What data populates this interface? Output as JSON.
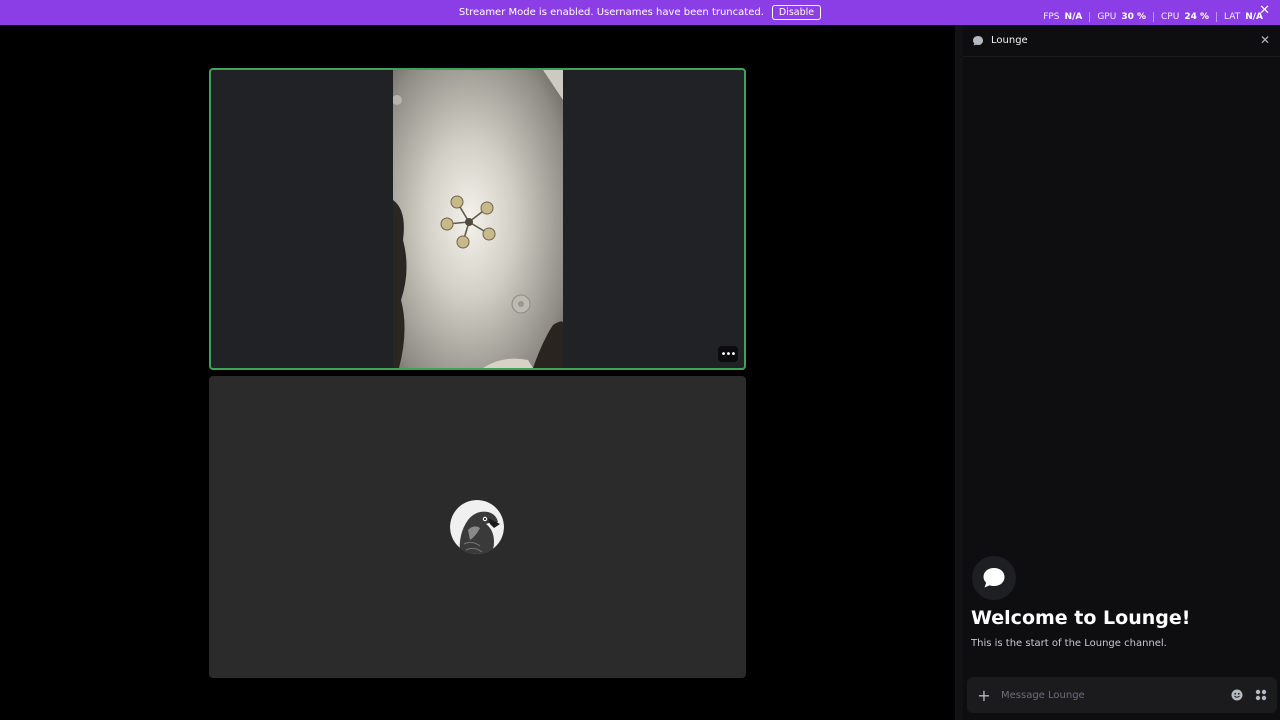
{
  "banner": {
    "message": "Streamer Mode is enabled. Usernames have been truncated.",
    "button_label": "Disable",
    "close_glyph": "✕",
    "color": "#8c3ee6"
  },
  "stats": [
    {
      "label": "FPS",
      "value": "N/A"
    },
    {
      "label": "GPU",
      "value": "30 %"
    },
    {
      "label": "CPU",
      "value": "24 %"
    },
    {
      "label": "LAT",
      "value": "N/A"
    }
  ],
  "stage": {
    "video_tile": {
      "more_glyph": "•••",
      "speaking_color": "#3ba55c"
    },
    "avatar_tile": {
      "avatar_icon": "eagle-avatar-icon"
    }
  },
  "panel": {
    "title": "Lounge",
    "close_glyph": "✕",
    "welcome_title": "Welcome to Lounge!",
    "welcome_subtitle": "This is the start of the Lounge channel.",
    "composer": {
      "add_glyph": "+",
      "placeholder": "Message Lounge"
    }
  }
}
